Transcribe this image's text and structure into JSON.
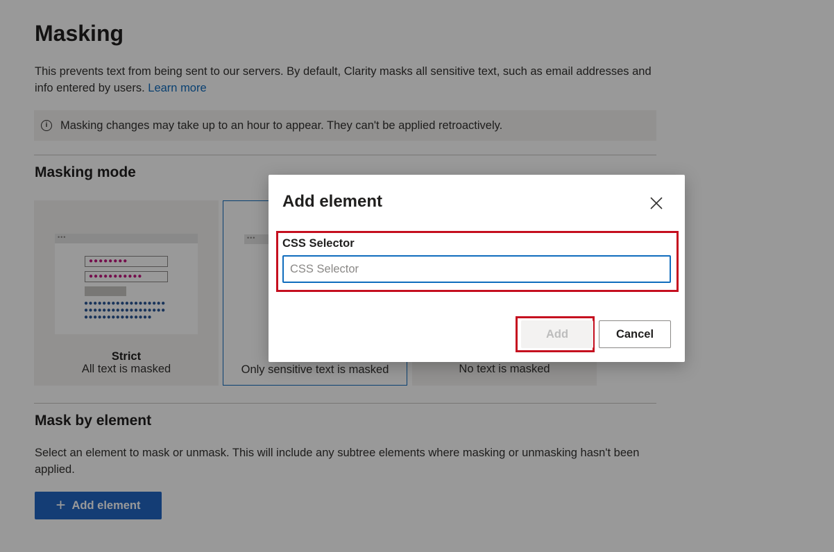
{
  "page": {
    "title": "Masking",
    "description": "This prevents text from being sent to our servers. By default, Clarity masks all sensitive text, such as email addresses and info entered by users.",
    "learn_more": "Learn more",
    "info_banner": "Masking changes may take up to an hour to appear. They can't be applied retroactively."
  },
  "masking_mode": {
    "heading": "Masking mode",
    "options": [
      {
        "title": "Strict",
        "subtitle": "All text is masked",
        "selected": false
      },
      {
        "title": "",
        "subtitle": "Only sensitive text is masked",
        "selected": true
      },
      {
        "title": "",
        "subtitle": "No text is masked",
        "selected": false
      }
    ],
    "illus_dots_row": "●●●●●●●●",
    "illus_dots_row2": "●●●●●●●●●●●",
    "illus_blue_dots": "●●●●●●●●●●●●●●●●●●●●●●●●●●●●●●●●●●●●●●●●●●●●●●●●●●●",
    "illus_window_dots": "•••"
  },
  "mask_by_element": {
    "heading": "Mask by element",
    "description": "Select an element to mask or unmask. This will include any subtree elements where masking or unmasking hasn't been applied.",
    "add_button": "Add element"
  },
  "dialog": {
    "title": "Add element",
    "field_label": "CSS Selector",
    "field_value": "",
    "field_placeholder": "CSS Selector",
    "add_button": "Add",
    "cancel_button": "Cancel",
    "add_disabled": true
  },
  "icons": {
    "info": "info-icon",
    "close": "close-icon",
    "plus": "plus-icon"
  },
  "colors": {
    "accent": "#0f6cbd",
    "primary_button": "#2266c4",
    "highlight": "#c50f1f",
    "masked_text": "#c2187f",
    "illustration_dots": "#2b5797"
  }
}
